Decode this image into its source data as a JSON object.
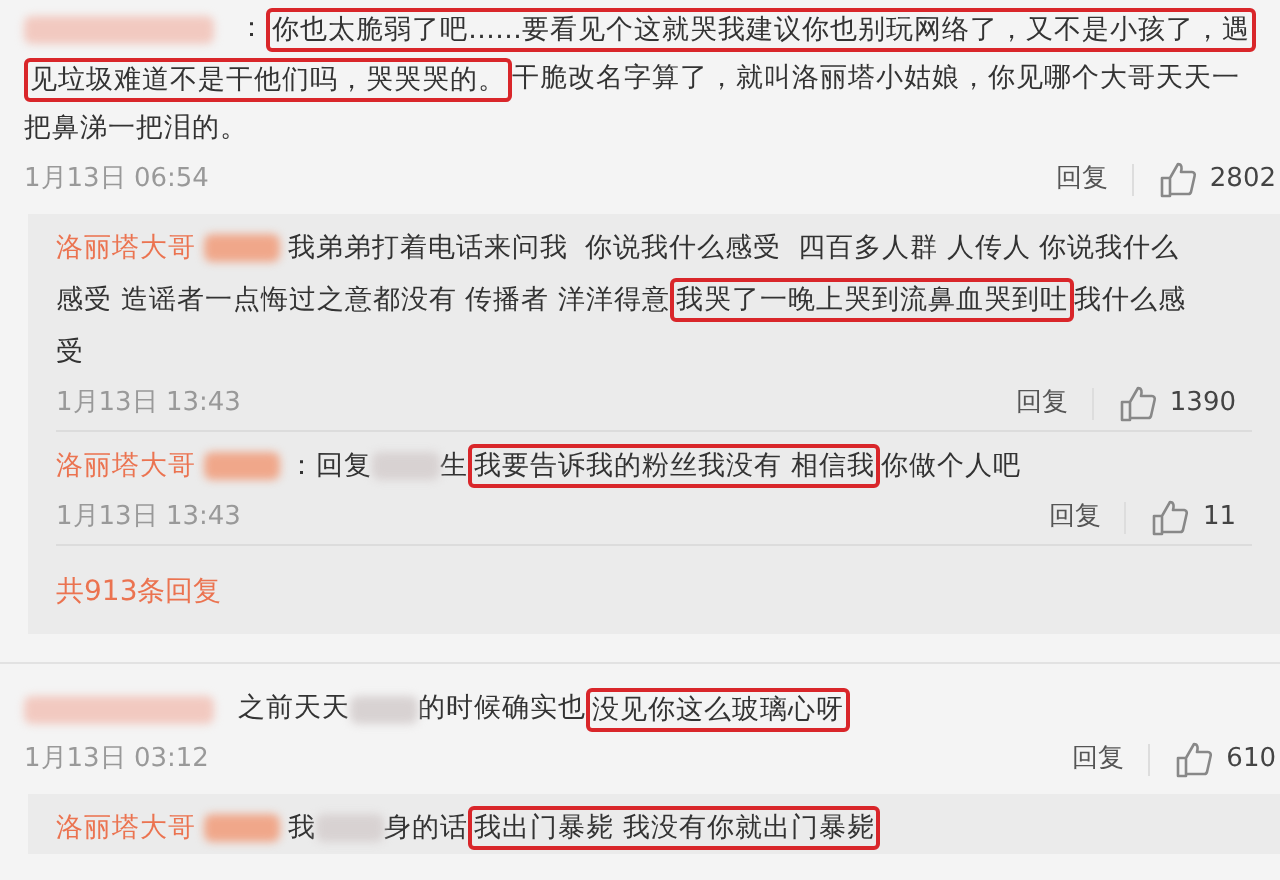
{
  "comments": [
    {
      "lines": [
        [
          {
            "kind": "blur"
          },
          {
            "kind": "text",
            "text": "："
          },
          {
            "kind": "highlight",
            "text": "你也太脆弱了吧……要看见个这就哭我建议你也别玩网络了，又不是小孩了，遇"
          }
        ],
        [
          {
            "kind": "highlight",
            "text": "见垃圾难道不是干他们吗，哭哭哭的。"
          },
          {
            "kind": "text",
            "text": "干脆改名字算了，就叫洛丽塔小姑娘，你见哪个大哥天天一"
          }
        ],
        [
          {
            "kind": "text",
            "text": "把鼻涕一把泪的。"
          }
        ]
      ],
      "time": "1月13日 06:54",
      "reply_label": "回复",
      "likes": "2802",
      "replies": [
        {
          "user": "洛丽塔大哥",
          "lines": [
            [
              {
                "kind": "blur"
              },
              {
                "kind": "text",
                "text": "我弟弟打着电话来问我  你说我什么感受  四百多人群 人传人 你说我什么"
              }
            ],
            [
              {
                "kind": "text",
                "text": "感受 造谣者一点悔过之意都没有 传播者 洋洋得意"
              },
              {
                "kind": "highlight",
                "text": "我哭了一晚上哭到流鼻血哭到吐"
              },
              {
                "kind": "text",
                "text": "我什么感"
              }
            ],
            [
              {
                "kind": "text",
                "text": "受"
              }
            ]
          ],
          "time": "1月13日 13:43",
          "reply_label": "回复",
          "likes": "1390"
        },
        {
          "user": "洛丽塔大哥",
          "lines": [
            [
              {
                "kind": "blur"
              },
              {
                "kind": "text",
                "text": "：回复"
              },
              {
                "kind": "blur"
              },
              {
                "kind": "text",
                "text": "生"
              },
              {
                "kind": "highlight",
                "text": "我要告诉我的粉丝我没有 相信我"
              },
              {
                "kind": "text",
                "text": "你做个人吧"
              }
            ]
          ],
          "time": "1月13日 13:43",
          "reply_label": "回复",
          "likes": "11"
        }
      ],
      "more_replies": "共913条回复"
    },
    {
      "lines": [
        [
          {
            "kind": "blur"
          },
          {
            "kind": "text",
            "text": "之前天天"
          },
          {
            "kind": "blur"
          },
          {
            "kind": "text",
            "text": "的时候确实也"
          },
          {
            "kind": "highlight",
            "text": "没见你这么玻璃心呀"
          }
        ]
      ],
      "time": "1月13日 03:12",
      "reply_label": "回复",
      "likes": "610",
      "replies": [
        {
          "user": "洛丽塔大哥",
          "lines": [
            [
              {
                "kind": "blur"
              },
              {
                "kind": "text",
                "text": "我"
              },
              {
                "kind": "blur"
              },
              {
                "kind": "text",
                "text": "身的话"
              },
              {
                "kind": "highlight",
                "text": "我出门暴毙 我没有你就出门暴毙"
              }
            ]
          ]
        }
      ]
    }
  ]
}
